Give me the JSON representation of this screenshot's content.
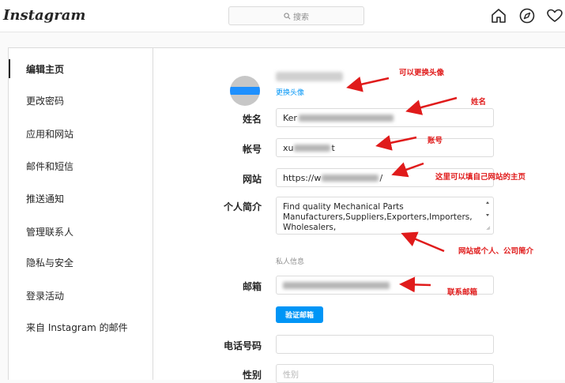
{
  "header": {
    "logo": "Instagram",
    "search_placeholder": "搜索",
    "icons": [
      "home-icon",
      "explore-icon",
      "heart-icon"
    ]
  },
  "sidebar": {
    "items": [
      {
        "label": "编辑主页",
        "active": true
      },
      {
        "label": "更改密码"
      },
      {
        "label": "应用和网站"
      },
      {
        "label": "邮件和短信"
      },
      {
        "label": "推送通知"
      },
      {
        "label": "管理联系人"
      },
      {
        "label": "隐私与安全"
      },
      {
        "label": "登录活动"
      },
      {
        "label": "来自 Instagram 的邮件"
      }
    ]
  },
  "profile": {
    "change_photo": "更换头像"
  },
  "form": {
    "name_label": "姓名",
    "name_value": "Ker",
    "username_label": "帐号",
    "username_value_prefix": "xu",
    "username_value_suffix": "t",
    "website_label": "网站",
    "website_prefix": "https://w",
    "website_suffix": "/",
    "bio_label": "个人简介",
    "bio_value": "Find quality Mechanical Parts Manufacturers,Suppliers,Exporters,Importers, Wholesalers,",
    "private_info": "私人信息",
    "email_label": "邮箱",
    "verify_email": "验证邮箱",
    "phone_label": "电话号码",
    "gender_label": "性别",
    "gender_placeholder": "性别"
  },
  "annotations": {
    "avatar": "可以更换头像",
    "name": "姓名",
    "username": "账号",
    "website": "这里可以填自己网站的主页",
    "bio": "网站或个人、公司简介",
    "email": "联系邮箱"
  },
  "colors": {
    "accent": "#0095f6",
    "annotation": "#e01b1b"
  }
}
